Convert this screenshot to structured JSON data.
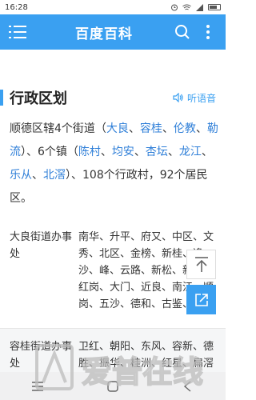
{
  "status_bar": {
    "time": "16:28"
  },
  "header": {
    "title": "百度百科"
  },
  "section": {
    "title": "行政区划",
    "listen_label": "听语音"
  },
  "intro": {
    "t1": "顺德区辖4个街道（",
    "l1": "大良",
    "s1": "、",
    "l2": "容桂",
    "s2": "、",
    "l3": "伦教",
    "s3": "、",
    "l4": "勒流",
    "t2": "）、6个镇（",
    "l5": "陈村",
    "s4": "、",
    "l6": "均安",
    "s5": "、",
    "l7": "杏坛",
    "s6": "、",
    "l8": "龙江",
    "s7": "、",
    "l9": "乐从",
    "s8": "、",
    "l10": "北滘",
    "t3": "）、108个行政村，92个居民区。"
  },
  "table": {
    "rows": [
      {
        "name": "大良街道办事处",
        "content": "南华、升平、府又、中区、文秀、北区、金榜、新桂、逢沙、峰、云路、新松、新滘、红岗、大门、近良、南江、顺岗、五沙、德和、古鉴、连沙"
      },
      {
        "name": "容桂街道办事处",
        "content": "卫红、朝阳、东风、容新、德胜、振华、桂洲、红星、扁滘"
      }
    ]
  },
  "watermark": {
    "text": "爱普在线"
  },
  "colors": {
    "accent": "#3aa0f1",
    "link": "#2f7fd8"
  }
}
